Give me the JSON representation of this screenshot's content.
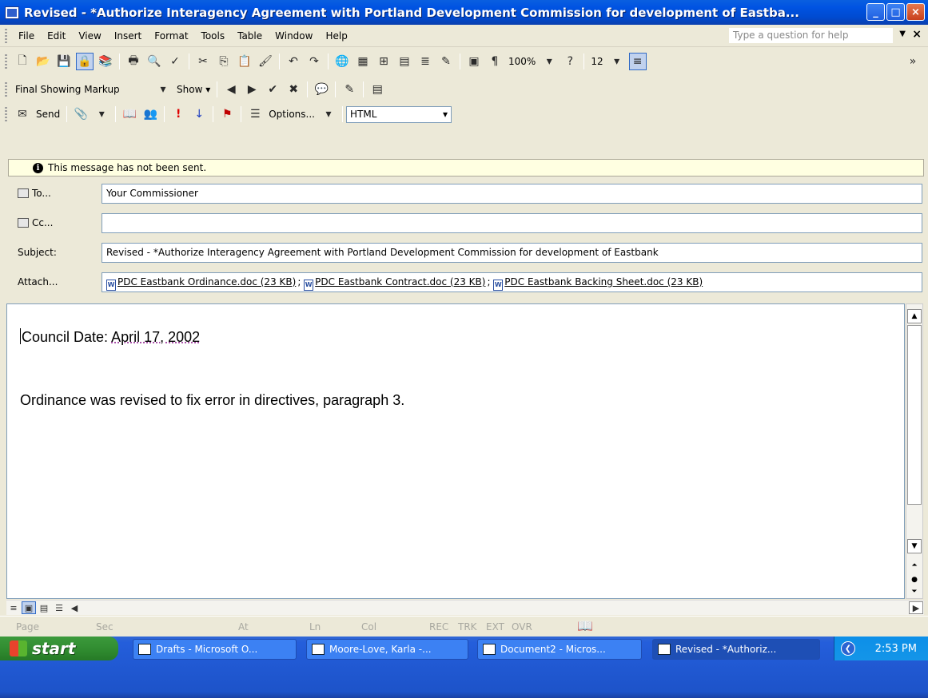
{
  "window": {
    "title": "Revised - *Authorize Interagency Agreement with Portland Development Commission for development of Eastba...",
    "minimize": "_",
    "maximize": "□",
    "close": "×"
  },
  "menu": {
    "items": [
      "File",
      "Edit",
      "View",
      "Insert",
      "Format",
      "Tools",
      "Table",
      "Window",
      "Help"
    ],
    "help_placeholder": "Type a question for help"
  },
  "toolbar_standard": {
    "zoom": "100%",
    "font_size": "12"
  },
  "toolbar_review": {
    "display_mode": "Final Showing Markup",
    "show_label": "Show ▾"
  },
  "toolbar_email": {
    "send_label": "Send",
    "options_label": "Options...",
    "format": "HTML"
  },
  "infobar": {
    "message": "This message has not been sent."
  },
  "header": {
    "to_label": "To...",
    "to_value": "Your Commissioner",
    "cc_label": "Cc...",
    "cc_value": "",
    "subject_label": "Subject:",
    "subject_value": "Revised - *Authorize Interagency Agreement with Portland Development Commission for development of Eastbank",
    "attach_label": "Attach...",
    "attachments": [
      "PDC Eastbank Ordinance.doc (23 KB)",
      "PDC Eastbank Contract.doc (23 KB)",
      "PDC Eastbank Backing Sheet.doc (23 KB)"
    ]
  },
  "body": {
    "date_label": "Council Date:  ",
    "date_value": "April 17, 2002",
    "line2": "Ordinance was revised to fix error in directives, paragraph 3."
  },
  "statusbar": {
    "page": "Page",
    "sec": "Sec",
    "at": "At",
    "ln": "Ln",
    "col": "Col",
    "rec": "REC",
    "trk": "TRK",
    "ext": "EXT",
    "ovr": "OVR"
  },
  "taskbar": {
    "start": "start",
    "tasks": [
      "Drafts - Microsoft O...",
      "Moore-Love, Karla -...",
      "Document2 - Micros...",
      "Revised - *Authoriz..."
    ],
    "clock": "2:53 PM"
  },
  "colors": {
    "titlebar": "#0053e2",
    "infobar": "#ffffe1",
    "taskbar": "#245edb",
    "start": "#2f8a2f"
  }
}
